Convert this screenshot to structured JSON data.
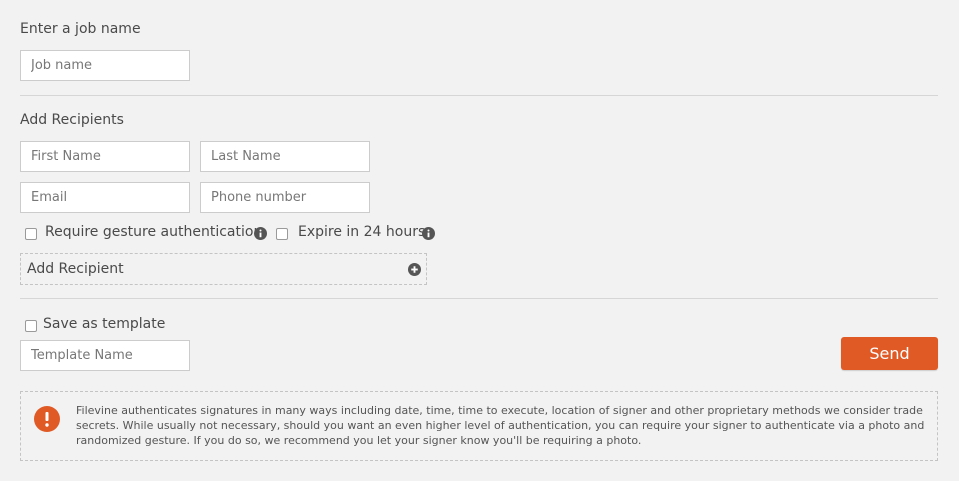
{
  "job": {
    "section_label": "Enter a job name",
    "name_placeholder": "Job name"
  },
  "recipients": {
    "section_label": "Add Recipients",
    "first_name_placeholder": "First Name",
    "last_name_placeholder": "Last Name",
    "email_placeholder": "Email",
    "phone_placeholder": "Phone number",
    "require_gesture_label": "Require gesture authentication",
    "expire_label": "Expire in 24 hours",
    "add_recipient_label": "Add Recipient"
  },
  "template": {
    "save_label": "Save as template",
    "name_placeholder": "Template Name"
  },
  "actions": {
    "send_label": "Send"
  },
  "notice": {
    "text": "Filevine authenticates signatures in many ways including date, time, time to execute, location of signer and other proprietary methods we consider trade secrets. While usually not necessary, should you want an even higher level of authentication, you can require your signer to authenticate via a photo and randomized gesture. If you do so, we recommend you let your signer know you'll be requiring a photo."
  },
  "colors": {
    "accent": "#e05a26",
    "background": "#f2f2f2"
  },
  "icons": {
    "info": "info-icon",
    "add": "plus-circle-icon",
    "notice": "info-circle-icon"
  }
}
